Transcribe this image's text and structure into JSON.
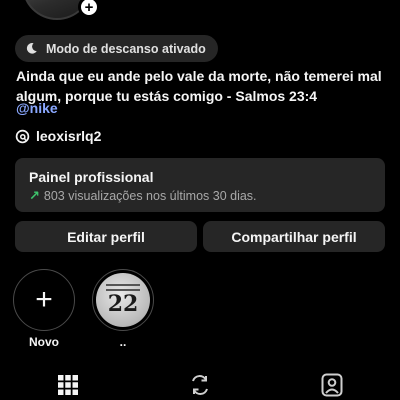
{
  "profile": {
    "status_pill": {
      "label": "Modo de descanso ativado",
      "icon": "moon-icon"
    },
    "bio": "Ainda que eu ande pelo vale da morte, não temerei mal algum, porque tu estás comigo - Salmos 23:4",
    "mention": "@nike",
    "threads_handle": "leoxisrlq2"
  },
  "professional_panel": {
    "title": "Painel profissional",
    "subtitle": "803 visualizações nos últimos 30 dias."
  },
  "actions": {
    "edit_label": "Editar perfil",
    "share_label": "Compartilhar perfil"
  },
  "highlights": [
    {
      "label": "Novo",
      "icon": "plus-icon"
    },
    {
      "label": "..",
      "cover_number": "22"
    }
  ],
  "tabs": [
    {
      "icon": "grid-icon"
    },
    {
      "icon": "reels-icon"
    },
    {
      "icon": "tagged-icon"
    }
  ],
  "colors": {
    "background": "#000000",
    "surface": "#262626",
    "mention": "#8aa8ff",
    "trend_up": "#3ec46d"
  }
}
